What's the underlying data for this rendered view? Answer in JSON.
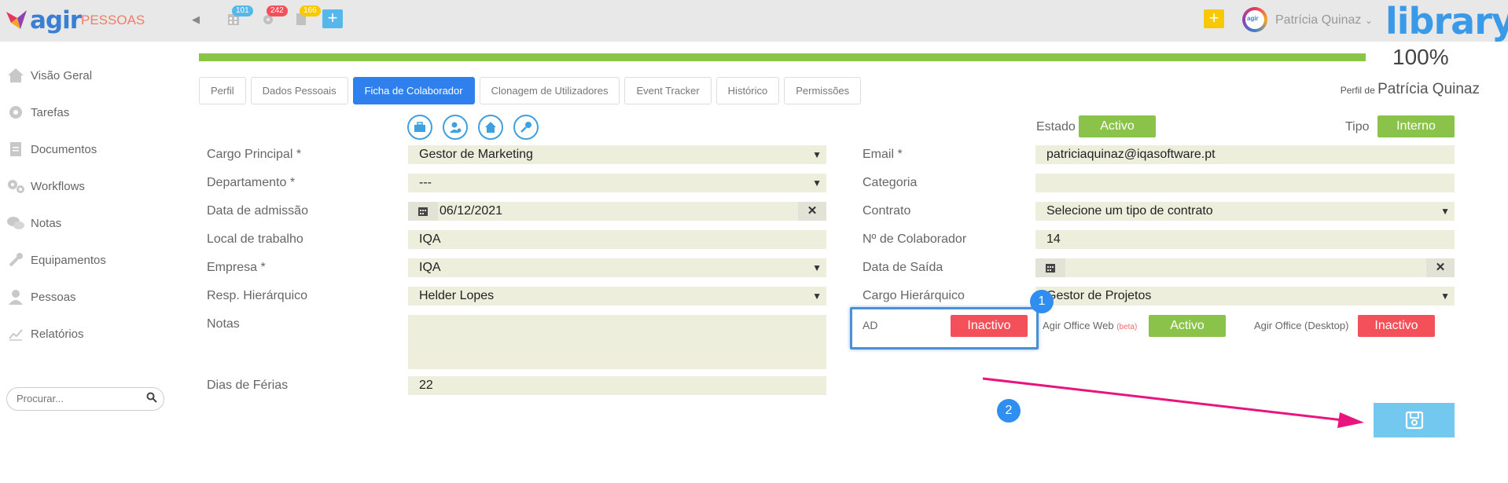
{
  "header": {
    "logo_text": "agir",
    "module": "PESSOAS",
    "badges": {
      "tasks": "101",
      "notifications": "242",
      "docs": "166"
    },
    "add_label": "+",
    "quick_add_label": "+",
    "avatar_text": "agir",
    "user_name": "Patrícia Quinaz",
    "brand": "library"
  },
  "sidebar": {
    "items": [
      {
        "label": "Visão Geral",
        "icon": "home-icon"
      },
      {
        "label": "Tarefas",
        "icon": "gear-icon"
      },
      {
        "label": "Documentos",
        "icon": "document-icon"
      },
      {
        "label": "Workflows",
        "icon": "gears-icon"
      },
      {
        "label": "Notas",
        "icon": "chat-icon"
      },
      {
        "label": "Equipamentos",
        "icon": "wrench-icon"
      },
      {
        "label": "Pessoas",
        "icon": "person-icon"
      },
      {
        "label": "Relatórios",
        "icon": "chart-icon"
      }
    ],
    "search_placeholder": "Procurar..."
  },
  "progress": {
    "percent": 100,
    "label": "100%"
  },
  "tabs": [
    {
      "label": "Perfil"
    },
    {
      "label": "Dados Pessoais"
    },
    {
      "label": "Ficha de Colaborador",
      "active": true
    },
    {
      "label": "Clonagem de Utilizadores"
    },
    {
      "label": "Event Tracker"
    },
    {
      "label": "Histórico"
    },
    {
      "label": "Permissões"
    }
  ],
  "profile": {
    "prefix": "Perfil de",
    "name": "Patrícia Quinaz"
  },
  "status": {
    "estado_label": "Estado",
    "estado_value": "Activo",
    "tipo_label": "Tipo",
    "tipo_value": "Interno"
  },
  "form_left": {
    "cargo_label": "Cargo Principal *",
    "cargo_value": "Gestor de Marketing",
    "dept_label": "Departamento *",
    "dept_value": "---",
    "admissao_label": "Data de admissão",
    "admissao_value": "06/12/2021",
    "local_label": "Local de trabalho",
    "local_value": "IQA",
    "empresa_label": "Empresa *",
    "empresa_value": "IQA",
    "resp_label": "Resp. Hierárquico",
    "resp_value": "Helder Lopes",
    "notas_label": "Notas",
    "notas_value": "",
    "ferias_label": "Dias de Férias",
    "ferias_value": "22"
  },
  "form_right": {
    "email_label": "Email *",
    "email_value": "patriciaquinaz@iqasoftware.pt",
    "categoria_label": "Categoria",
    "categoria_value": "",
    "contrato_label": "Contrato",
    "contrato_value": "Selecione um tipo de contrato",
    "num_label": "Nº de Colaborador",
    "num_value": "14",
    "saida_label": "Data de Saída",
    "saida_value": "",
    "cargo_h_label": "Cargo Hierárquico",
    "cargo_h_value": "Gestor de Projetos"
  },
  "integrations": {
    "ad_label": "AD",
    "ad_value": "Inactivo",
    "web_label": "Agir Office Web",
    "web_beta": "(beta)",
    "web_value": "Activo",
    "desktop_label": "Agir Office (Desktop)",
    "desktop_value": "Inactivo"
  },
  "markers": {
    "one": "1",
    "two": "2"
  },
  "colors": {
    "accent": "#2f80ed",
    "active": "#8bc34a",
    "inactive": "#f4505a",
    "highlight": "#4a90d9",
    "annotation_arrow": "#e8157f"
  }
}
